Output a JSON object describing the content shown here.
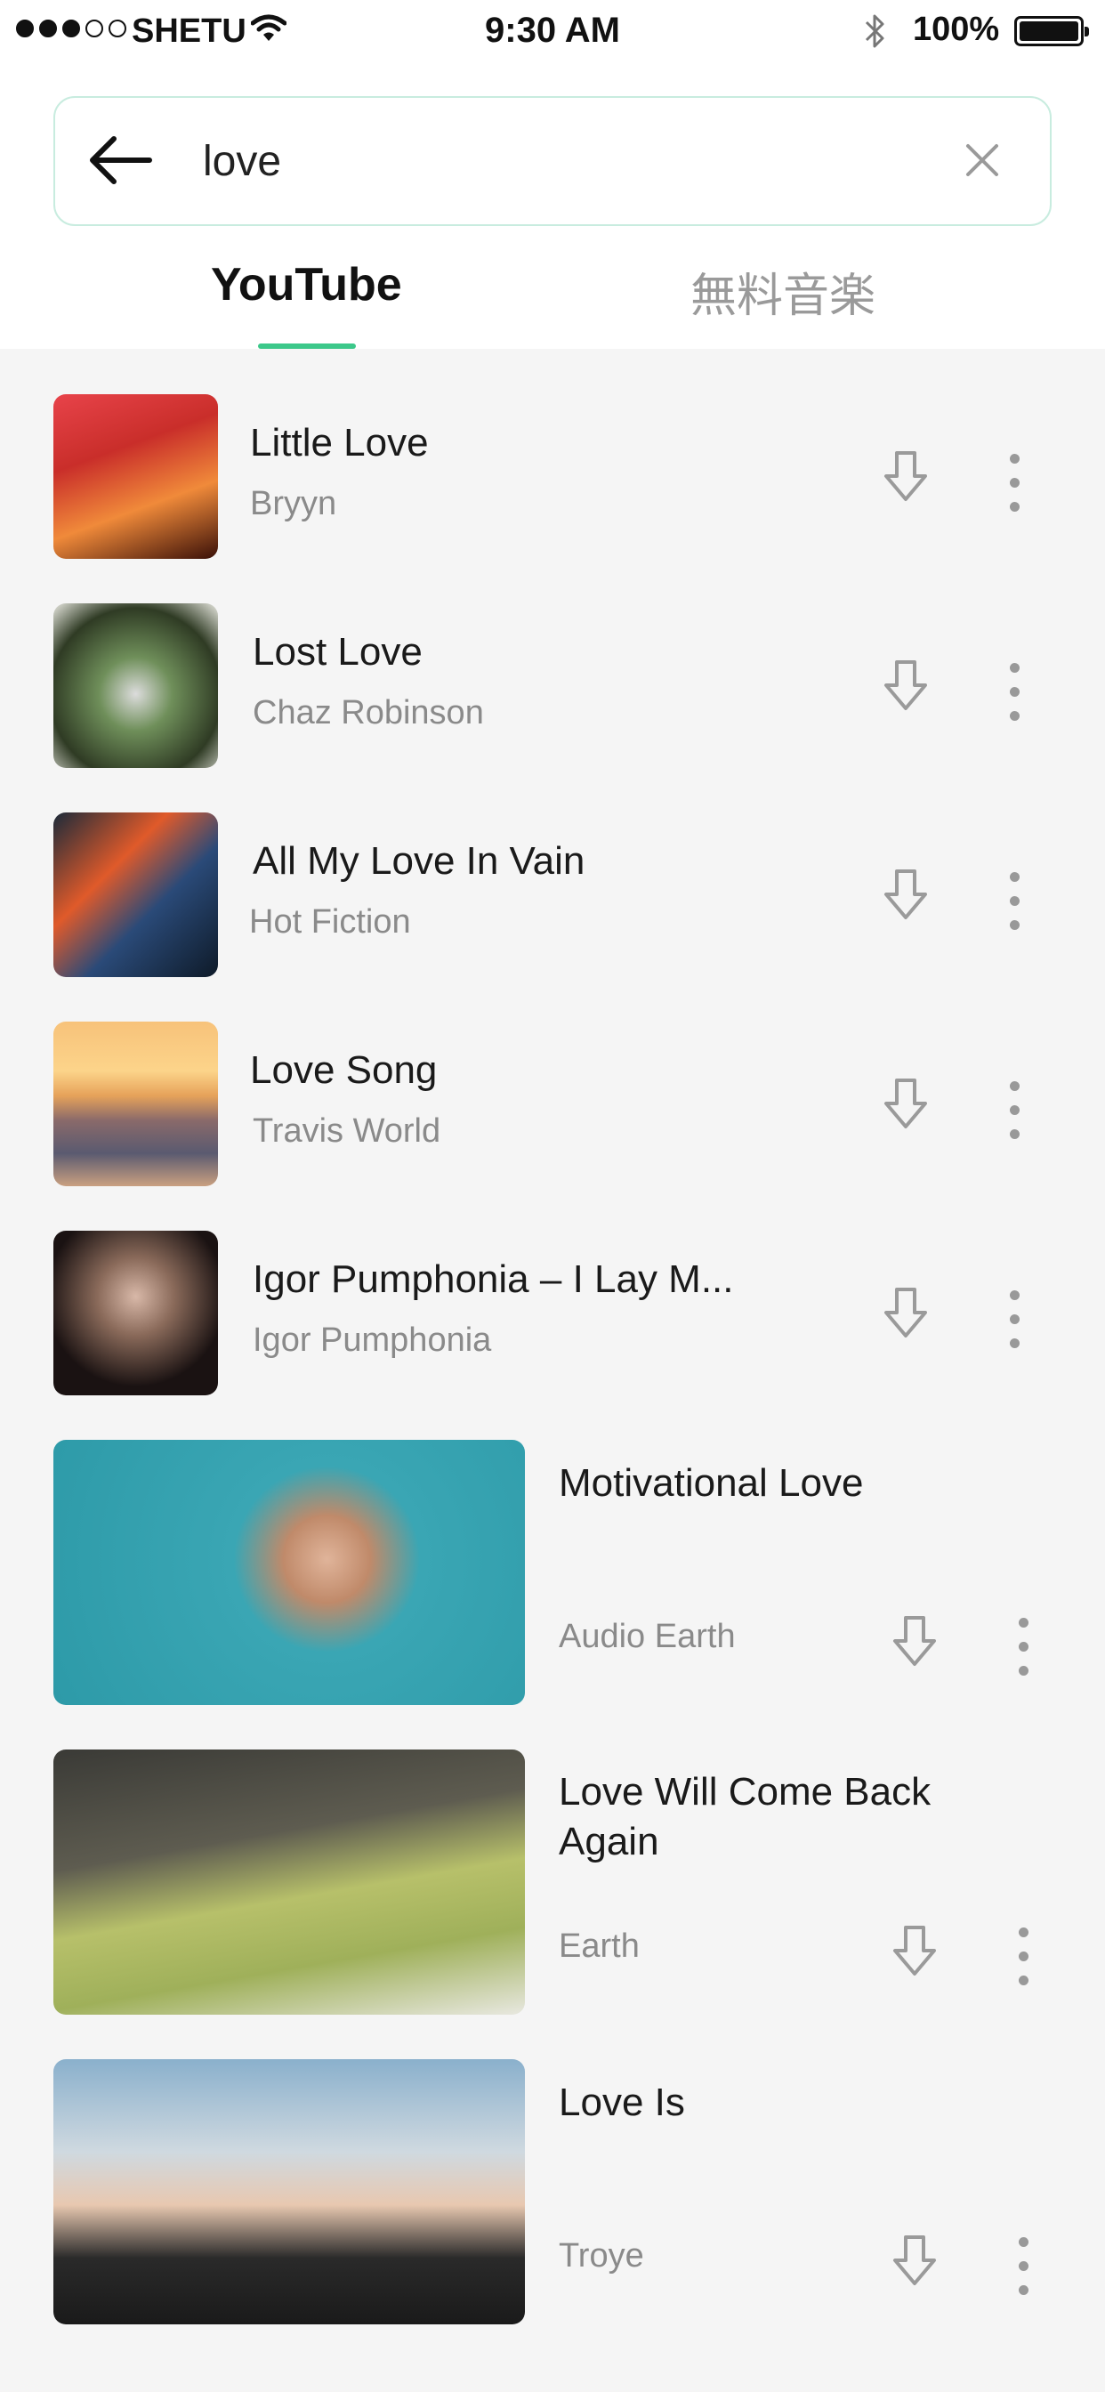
{
  "status_bar": {
    "carrier": "SHETU",
    "time": "9:30 AM",
    "battery": "100%"
  },
  "search": {
    "query": "love"
  },
  "tabs": [
    {
      "label": "YouTube",
      "active": true
    },
    {
      "label": "無料音楽",
      "active": false
    }
  ],
  "results": [
    {
      "title": "Little Love",
      "artist": "Bryyn"
    },
    {
      "title": "Lost Love",
      "artist": "Chaz Robinson"
    },
    {
      "title": "All My Love In Vain",
      "artist": "Hot Fiction"
    },
    {
      "title": "Love Song",
      "artist": "Travis World"
    },
    {
      "title": "Igor Pumphonia – I Lay M...",
      "artist": "Igor Pumphonia"
    },
    {
      "title": "Motivational Love",
      "artist": "Audio Earth"
    },
    {
      "title": "Love Will Come Back\nAgain",
      "artist": "Earth"
    },
    {
      "title": "Love Is",
      "artist": "Troye"
    }
  ],
  "colors": {
    "accent": "#3cc88a",
    "search_border": "#c8ecdf",
    "background": "#f5f5f5",
    "icon_gray": "#9a9a9a"
  },
  "icons": {
    "back": "arrow-left-icon",
    "clear": "close-icon",
    "download": "download-arrow-icon",
    "more": "more-vertical-icon"
  }
}
